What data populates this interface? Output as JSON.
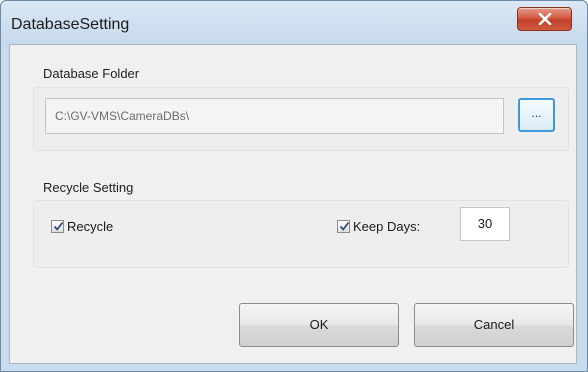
{
  "window": {
    "title": "DatabaseSetting",
    "close_glyph": "close-icon"
  },
  "database_folder": {
    "group_label": "Database Folder",
    "path_value": "C:\\GV-VMS\\CameraDBs\\",
    "browse_label": "..."
  },
  "recycle_setting": {
    "group_label": "Recycle Setting",
    "recycle_label": "Recycle",
    "recycle_checked": true,
    "keep_days_label": "Keep Days:",
    "keep_days_checked": true,
    "keep_days_value": "30"
  },
  "buttons": {
    "ok_label": "OK",
    "cancel_label": "Cancel"
  },
  "colors": {
    "titlebar": "#c9dcee",
    "close_button": "#c9462f",
    "dialog_face": "#f0f0f0",
    "browse_accent": "#3c9ad8"
  }
}
